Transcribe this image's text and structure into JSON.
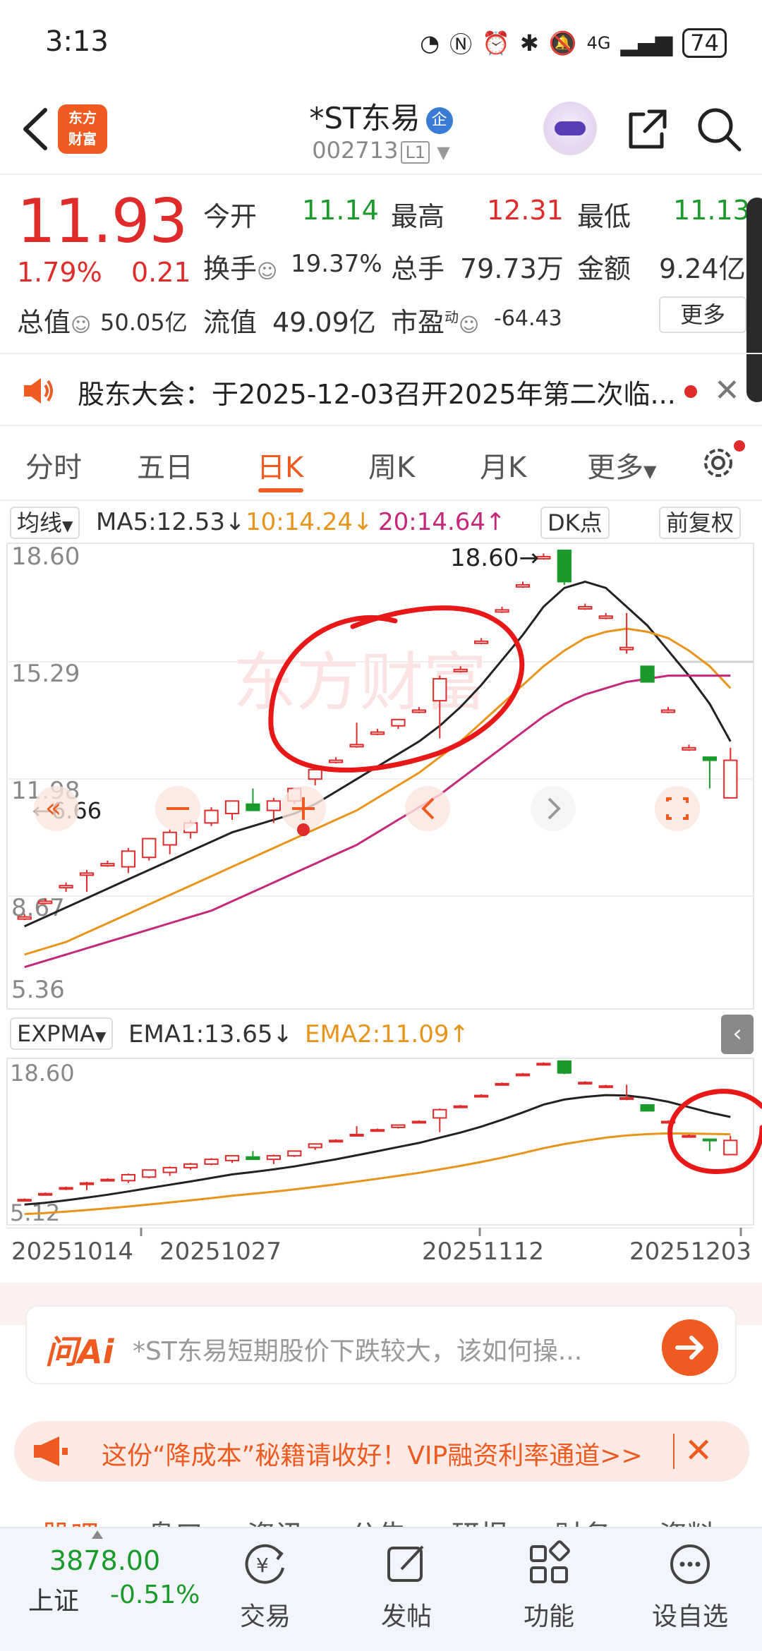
{
  "status_bar": {
    "time": "3:13",
    "network": "4G",
    "battery": "74"
  },
  "header": {
    "logo_text_1": "东方",
    "logo_text_2": "财富",
    "stock_name": "*ST东易",
    "enterprise_badge": "企",
    "stock_code": "002713",
    "level_badge": "L1"
  },
  "quote": {
    "price": "11.93",
    "change_pct": "1.79%",
    "change_amt": "0.21",
    "open_label": "今开",
    "open": "11.14",
    "high_label": "最高",
    "high": "12.31",
    "low_label": "最低",
    "low": "11.13",
    "turnover_label": "换手",
    "turnover": "19.37%",
    "volume_label": "总手",
    "volume": "79.73万",
    "amount_label": "金额",
    "amount": "9.24亿",
    "mktcap_label": "总值",
    "mktcap": "50.05亿",
    "float_label": "流值",
    "float": "49.09亿",
    "pe_label": "市盈",
    "pe_sup": "动",
    "pe": "-64.43",
    "more_label": "更多"
  },
  "notice": {
    "text": "股东大会：于2025-12-03召开2025年第二次临..."
  },
  "tabs": [
    "分时",
    "五日",
    "日K",
    "周K",
    "月K",
    "更多"
  ],
  "active_tab": "日K",
  "ma_bar": {
    "selector": "均线",
    "ma5": "MA5:12.53",
    "ma10": "10:14.24",
    "ma20": "20:14.64",
    "dk_label": "DK点",
    "adjust_label": "前复权"
  },
  "kline_axis": {
    "y_labels": [
      "18.60",
      "15.29",
      "11.98",
      "8.67",
      "5.36"
    ],
    "max_label": "18.60",
    "min_label": "6.66"
  },
  "ema_bar": {
    "selector": "EXPMA",
    "ema1": "EMA1:13.65",
    "ema2": "EMA2:11.09"
  },
  "ema_axis": {
    "top": "18.60",
    "bottom": "5.12"
  },
  "dates": [
    "20251014",
    "20251027",
    "20251112",
    "20251203"
  ],
  "ai": {
    "logo": "问Ai",
    "prompt": "*ST东易短期股价下跌较大，该如何操..."
  },
  "promo": {
    "text": "这份“降成本”秘籍请收好！VIP融资利率通道>>"
  },
  "peek_tabs": [
    "股吧",
    "盘口",
    "资讯",
    "公告",
    "研报",
    "财务",
    "资料"
  ],
  "bottom_nav": {
    "index_value": "3878.00",
    "index_name": "上证",
    "index_change": "-0.51%",
    "items": [
      "交易",
      "发帖",
      "功能",
      "设自选"
    ]
  },
  "colors": {
    "accent": "#ee5a1f",
    "up": "#e02b2b",
    "down": "#1a9a2a",
    "ma10": "#e8941a",
    "ma20": "#c5287a"
  },
  "chart_data": {
    "type": "candlestick",
    "title": "",
    "ylim": [
      5.36,
      18.6
    ],
    "x_labels": [
      "20251014",
      "20251027",
      "20251112",
      "20251203"
    ],
    "candles": [
      {
        "o": 6.9,
        "c": 6.9,
        "h": 7.0,
        "l": 6.8
      },
      {
        "o": 7.4,
        "c": 7.4,
        "h": 7.5,
        "l": 7.3
      },
      {
        "o": 7.9,
        "c": 7.9,
        "h": 8.0,
        "l": 7.7
      },
      {
        "o": 8.3,
        "c": 8.3,
        "h": 8.4,
        "l": 7.7
      },
      {
        "o": 8.6,
        "c": 8.6,
        "h": 8.7,
        "l": 8.5
      },
      {
        "o": 8.5,
        "c": 9.0,
        "h": 9.1,
        "l": 8.3
      },
      {
        "o": 8.8,
        "c": 9.4,
        "h": 9.4,
        "l": 8.7
      },
      {
        "o": 9.2,
        "c": 9.6,
        "h": 9.7,
        "l": 8.9
      },
      {
        "o": 9.6,
        "c": 9.9,
        "h": 10.0,
        "l": 9.4
      },
      {
        "o": 9.9,
        "c": 10.3,
        "h": 10.4,
        "l": 9.8
      },
      {
        "o": 10.2,
        "c": 10.6,
        "h": 10.6,
        "l": 10.0
      },
      {
        "o": 10.5,
        "c": 10.3,
        "h": 11.0,
        "l": 10.3
      },
      {
        "o": 10.3,
        "c": 10.6,
        "h": 10.7,
        "l": 9.9
      },
      {
        "o": 10.6,
        "c": 11.0,
        "h": 11.0,
        "l": 10.5
      },
      {
        "o": 11.3,
        "c": 11.6,
        "h": 11.6,
        "l": 11.1
      },
      {
        "o": 11.9,
        "c": 11.9,
        "h": 12.0,
        "l": 11.8
      },
      {
        "o": 12.4,
        "c": 12.4,
        "h": 13.1,
        "l": 12.3
      },
      {
        "o": 12.8,
        "c": 12.8,
        "h": 12.9,
        "l": 12.7
      },
      {
        "o": 13.0,
        "c": 13.2,
        "h": 13.2,
        "l": 12.9
      },
      {
        "o": 13.5,
        "c": 13.5,
        "h": 13.6,
        "l": 13.4
      },
      {
        "o": 13.8,
        "c": 14.5,
        "h": 14.6,
        "l": 12.6
      },
      {
        "o": 14.8,
        "c": 14.8,
        "h": 14.9,
        "l": 14.7
      },
      {
        "o": 15.7,
        "c": 15.7,
        "h": 15.8,
        "l": 15.6
      },
      {
        "o": 16.7,
        "c": 16.7,
        "h": 16.8,
        "l": 16.6
      },
      {
        "o": 17.5,
        "c": 17.5,
        "h": 17.6,
        "l": 17.4
      },
      {
        "o": 18.4,
        "c": 18.4,
        "h": 18.5,
        "l": 18.3
      },
      {
        "o": 18.6,
        "c": 17.6,
        "h": 18.6,
        "l": 17.5
      },
      {
        "o": 16.8,
        "c": 16.8,
        "h": 16.9,
        "l": 16.7
      },
      {
        "o": 16.5,
        "c": 16.5,
        "h": 16.6,
        "l": 16.4
      },
      {
        "o": 15.5,
        "c": 15.5,
        "h": 16.6,
        "l": 15.3
      },
      {
        "o": 14.9,
        "c": 14.4,
        "h": 14.9,
        "l": 14.4
      },
      {
        "o": 13.5,
        "c": 13.5,
        "h": 13.6,
        "l": 13.4
      },
      {
        "o": 12.3,
        "c": 12.3,
        "h": 12.4,
        "l": 12.2
      },
      {
        "o": 12.0,
        "c": 11.9,
        "h": 12.0,
        "l": 11.0
      },
      {
        "o": 10.7,
        "c": 11.9,
        "h": 12.3,
        "l": 10.7
      }
    ],
    "series": [
      {
        "name": "MA5",
        "values": [
          6.6,
          6.9,
          7.2,
          7.5,
          7.8,
          8.1,
          8.4,
          8.7,
          9.0,
          9.3,
          9.6,
          9.8,
          10.0,
          10.2,
          10.5,
          10.9,
          11.3,
          11.7,
          12.1,
          12.5,
          13.0,
          13.6,
          14.3,
          15.1,
          15.9,
          16.8,
          17.4,
          17.6,
          17.4,
          16.8,
          16.2,
          15.4,
          14.6,
          13.7,
          12.5
        ]
      },
      {
        "name": "MA10",
        "values": [
          5.7,
          5.9,
          6.1,
          6.4,
          6.7,
          7.0,
          7.3,
          7.6,
          7.9,
          8.2,
          8.5,
          8.8,
          9.1,
          9.4,
          9.7,
          10.0,
          10.3,
          10.7,
          11.1,
          11.5,
          12.0,
          12.5,
          13.1,
          13.7,
          14.3,
          14.9,
          15.4,
          15.8,
          16.0,
          16.1,
          16.0,
          15.8,
          15.4,
          14.9,
          14.2
        ]
      },
      {
        "name": "MA20",
        "values": [
          5.3,
          5.5,
          5.7,
          5.9,
          6.1,
          6.3,
          6.5,
          6.7,
          6.9,
          7.1,
          7.4,
          7.7,
          8.0,
          8.3,
          8.6,
          8.9,
          9.2,
          9.6,
          10.0,
          10.4,
          10.8,
          11.3,
          11.8,
          12.3,
          12.8,
          13.3,
          13.7,
          14.0,
          14.2,
          14.4,
          14.5,
          14.6,
          14.6,
          14.6,
          14.6
        ]
      }
    ]
  }
}
